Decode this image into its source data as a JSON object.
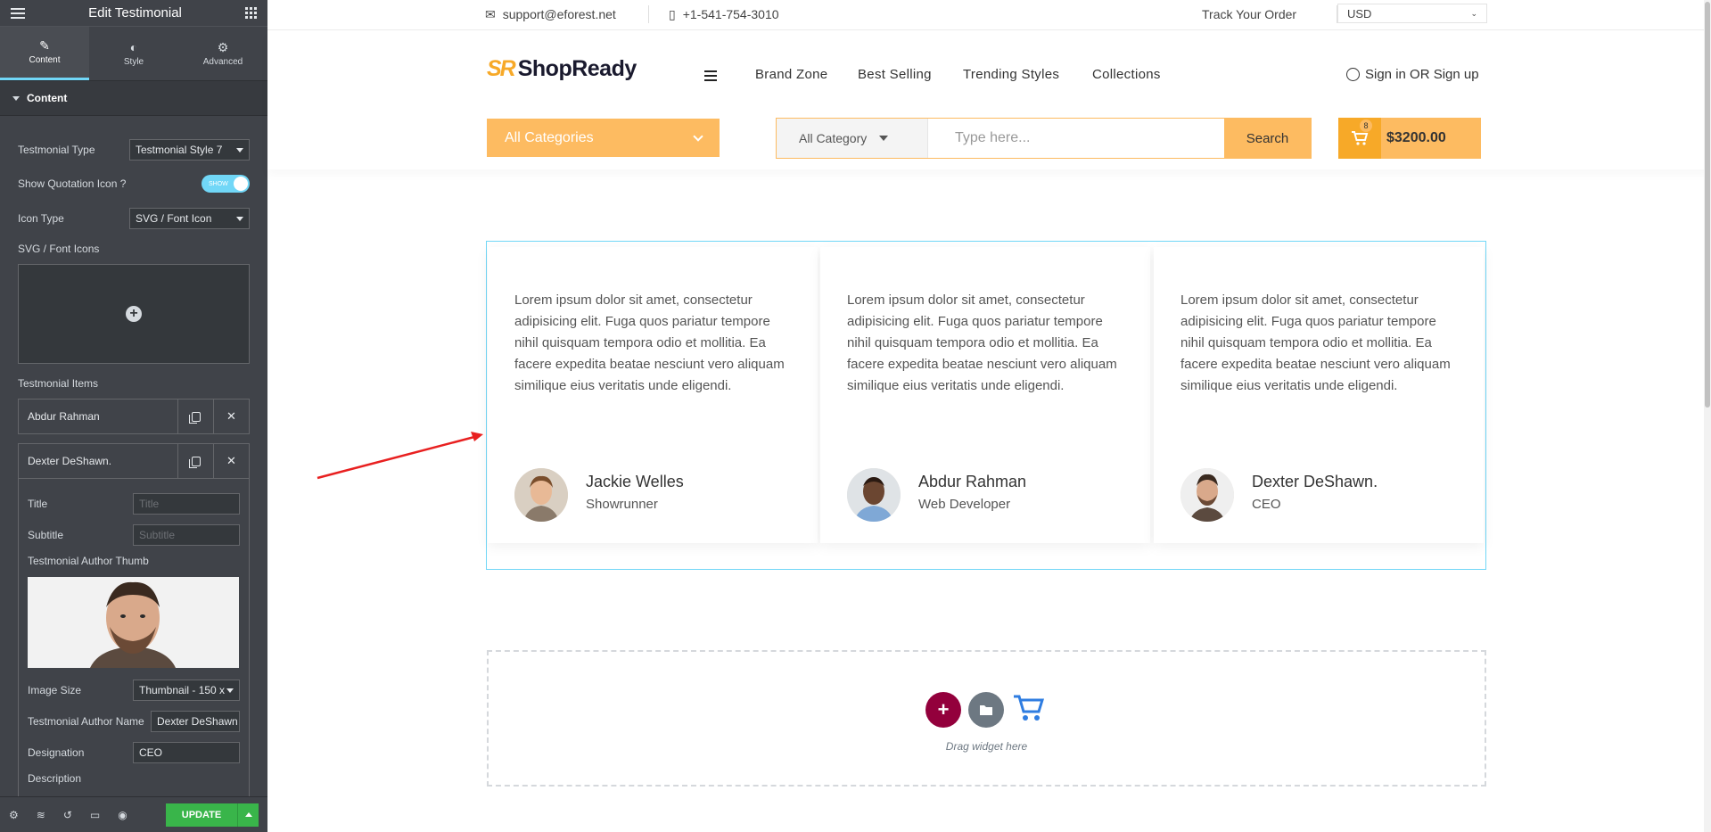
{
  "panel": {
    "title": "Edit Testimonial",
    "tabs": [
      {
        "label": "Content",
        "icon": "pencil-icon"
      },
      {
        "label": "Style",
        "icon": "contrast-icon"
      },
      {
        "label": "Advanced",
        "icon": "gear-icon"
      }
    ],
    "section_title": "Content",
    "controls": {
      "testimonial_type_label": "Testmonial Type",
      "testimonial_type_value": "Testmonial Style 7",
      "show_quote_label": "Show Quotation Icon ?",
      "show_quote_toggle": "SHOW",
      "icon_type_label": "Icon Type",
      "icon_type_value": "SVG / Font Icon",
      "svg_icons_label": "SVG / Font Icons",
      "items_label": "Testmonial Items"
    },
    "items": [
      {
        "name": "Abdur Rahman"
      },
      {
        "name": "Dexter DeShawn."
      }
    ],
    "item_fields": {
      "title_label": "Title",
      "title_placeholder": "Title",
      "subtitle_label": "Subtitle",
      "subtitle_placeholder": "Subtitle",
      "thumb_label": "Testmonial Author Thumb",
      "image_size_label": "Image Size",
      "image_size_value": "Thumbnail - 150 x",
      "author_name_label": "Testmonial Author Name",
      "author_name_value": "Dexter DeShawn",
      "designation_label": "Designation",
      "designation_value": "CEO",
      "description_label": "Description"
    },
    "footer": {
      "update_label": "UPDATE"
    }
  },
  "topbar": {
    "email": "support@eforest.net",
    "phone": "+1-541-754-3010",
    "track_order": "Track Your Order",
    "currency": "USD"
  },
  "header": {
    "logo_mark": "SR",
    "logo_text": "ShopReady",
    "nav": [
      "Brand Zone",
      "Best Selling",
      "Trending Styles",
      "Collections"
    ],
    "signin": "Sign in OR Sign up",
    "categories_button": "All Categories",
    "search_category": "All Category",
    "search_placeholder": "Type here...",
    "search_button": "Search",
    "cart_count": "8",
    "cart_total": "$3200.00"
  },
  "testimonials": [
    {
      "text": "Lorem ipsum dolor sit amet, consectetur adipisicing elit. Fuga quos pariatur tempore nihil quisquam tempora odio et mollitia. Ea facere expedita beatae nesciunt vero aliquam similique eius veritatis unde eligendi.",
      "name": "Jackie Welles",
      "role": "Showrunner"
    },
    {
      "text": "Lorem ipsum dolor sit amet, consectetur adipisicing elit. Fuga quos pariatur tempore nihil quisquam tempora odio et mollitia. Ea facere expedita beatae nesciunt vero aliquam similique eius veritatis unde eligendi.",
      "name": "Abdur Rahman",
      "role": "Web Developer"
    },
    {
      "text": "Lorem ipsum dolor sit amet, consectetur adipisicing elit. Fuga quos pariatur tempore nihil quisquam tempora odio et mollitia. Ea facere expedita beatae nesciunt vero aliquam similique eius veritatis unde eligendi.",
      "name": "Dexter DeShawn.",
      "role": "CEO"
    }
  ],
  "dropzone": {
    "text": "Drag widget here"
  },
  "colors": {
    "accent": "#fdbb61",
    "editor_accent": "#71d7f7",
    "update_green": "#39b54a",
    "add_section": "#93003c"
  }
}
